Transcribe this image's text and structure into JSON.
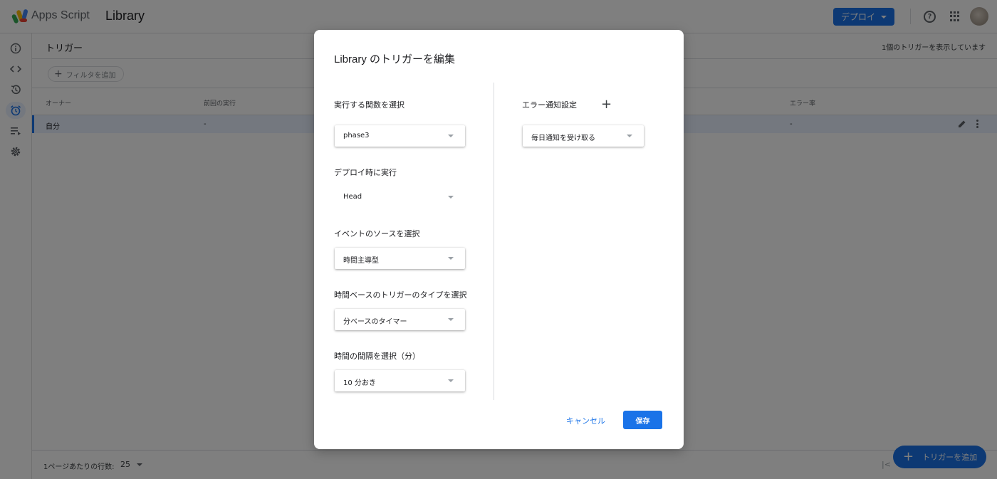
{
  "topbar": {
    "app_name": "Apps Script",
    "project_name": "Library",
    "deploy_label": "デプロイ"
  },
  "subheader": {
    "title": "トリガー",
    "count_text": "1個のトリガーを表示しています"
  },
  "filter": {
    "label": "フィルタを追加"
  },
  "table": {
    "columns": [
      "オーナー",
      "前回の実行",
      "エラー率"
    ],
    "rows": [
      {
        "owner": "自分",
        "last_run": "-",
        "error_rate": "-"
      }
    ]
  },
  "footer": {
    "rows_per_page_label": "1ページあたりの行数:",
    "rows_per_page_value": "25",
    "pager": "|<"
  },
  "fab": {
    "label": "トリガーを追加"
  },
  "dialog": {
    "title": "Library のトリガーを編集",
    "left": {
      "function_label": "実行する関数を選択",
      "function_value": "phase3",
      "deploy_label": "デプロイ時に実行",
      "deploy_value": "Head",
      "event_source_label": "イベントのソースを選択",
      "event_source_value": "時間主導型",
      "time_type_label": "時間ベースのトリガーのタイプを選択",
      "time_type_value": "分ベースのタイマー",
      "interval_label": "時間の間隔を選択（分）",
      "interval_value": "10 分おき"
    },
    "right": {
      "error_label": "エラー通知設定",
      "error_value": "毎日通知を受け取る"
    },
    "cancel_label": "キャンセル",
    "save_label": "保存"
  },
  "colors": {
    "accent": "#1a73e8",
    "selected_row": "#e8f0fe",
    "scrim": "rgba(0,0,0,0.5)"
  },
  "icons": [
    "apps-script-logo",
    "info-icon",
    "code-icon",
    "history-icon",
    "alarm-icon",
    "executions-icon",
    "settings-icon",
    "help-icon",
    "apps-grid-icon",
    "edit-icon",
    "more-vert-icon",
    "add-icon",
    "chevron-down-icon"
  ]
}
